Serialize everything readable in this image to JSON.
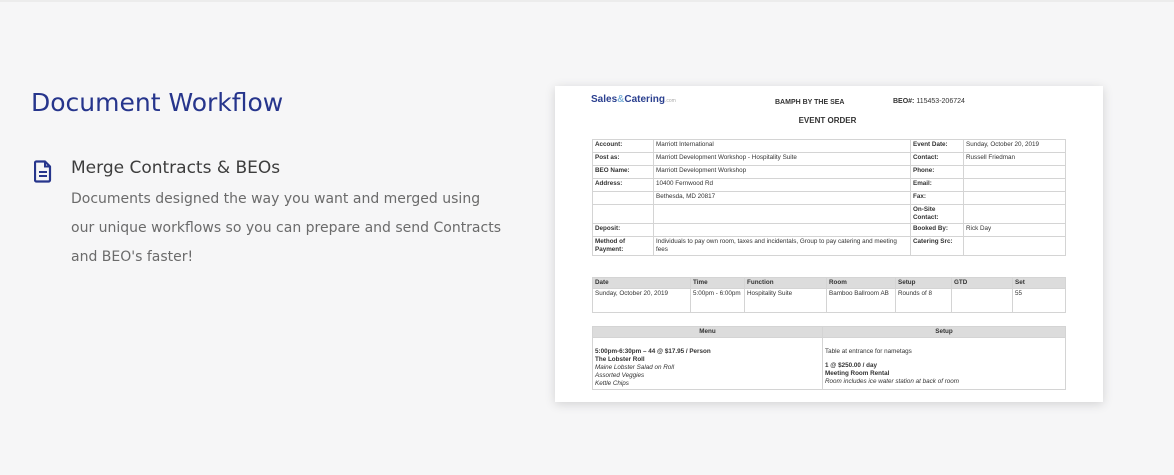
{
  "section": {
    "title": "Document Workflow",
    "feature_title": "Merge Contracts & BEOs",
    "feature_desc": "Documents designed the way you want and merged using our unique workflows so you can prepare and send Contracts and BEO's faster!",
    "icon": "file-text-icon",
    "accent": "#26358c"
  },
  "doc": {
    "logo": {
      "a": "Sales",
      "amp": "&",
      "b": "Catering",
      "com": ".com"
    },
    "hotel": "BAMPH BY THE SEA",
    "beo_label": "BEO#:",
    "beo_number": "115453-206724",
    "title": "EVENT ORDER",
    "info": [
      [
        "Account:",
        "Marriott International",
        "Event Date:",
        "Sunday, October 20, 2019"
      ],
      [
        "Post as:",
        "Marriott Development Workshop - Hospitality Suite",
        "Contact:",
        "Russell Friedman"
      ],
      [
        "BEO Name:",
        "Marriott Development Workshop",
        "Phone:",
        ""
      ],
      [
        "Address:",
        "10400 Fernwood Rd",
        "Email:",
        ""
      ],
      [
        "",
        "Bethesda, MD 20817",
        "Fax:",
        ""
      ],
      [
        "",
        "",
        "On-Site Contact:",
        ""
      ],
      [
        "Deposit:",
        "",
        "Booked By:",
        "Rick Day"
      ],
      [
        "Method of Payment:",
        "Individuals to pay own room, taxes and incidentals, Group to pay catering and meeting fees",
        "Catering Src:",
        ""
      ]
    ],
    "schedule": {
      "headers": [
        "Date",
        "Time",
        "Function",
        "Room",
        "Setup",
        "GTD",
        "Set"
      ],
      "rows": [
        [
          "Sunday, October 20, 2019",
          "5:00pm - 6:00pm",
          "Hospitality Suite",
          "Bamboo Ballroom AB",
          "Rounds of 8",
          "",
          "55"
        ]
      ]
    },
    "menu": {
      "headers": [
        "Menu",
        "Setup"
      ],
      "menu_time": "5:00pm-6:30pm – 44 @ $17.95 / Person",
      "menu_name": "The Lobster Roll",
      "menu_items": [
        "Maine Lobster Salad on Roll",
        "Assorted Veggies",
        "Kettle Chips"
      ],
      "setup_note": "Table at entrance for nametags",
      "setup_price": "1 @ $250.00 / day",
      "setup_name": "Meeting Room Rental",
      "setup_desc": "Room includes ice water station at back of room"
    }
  }
}
